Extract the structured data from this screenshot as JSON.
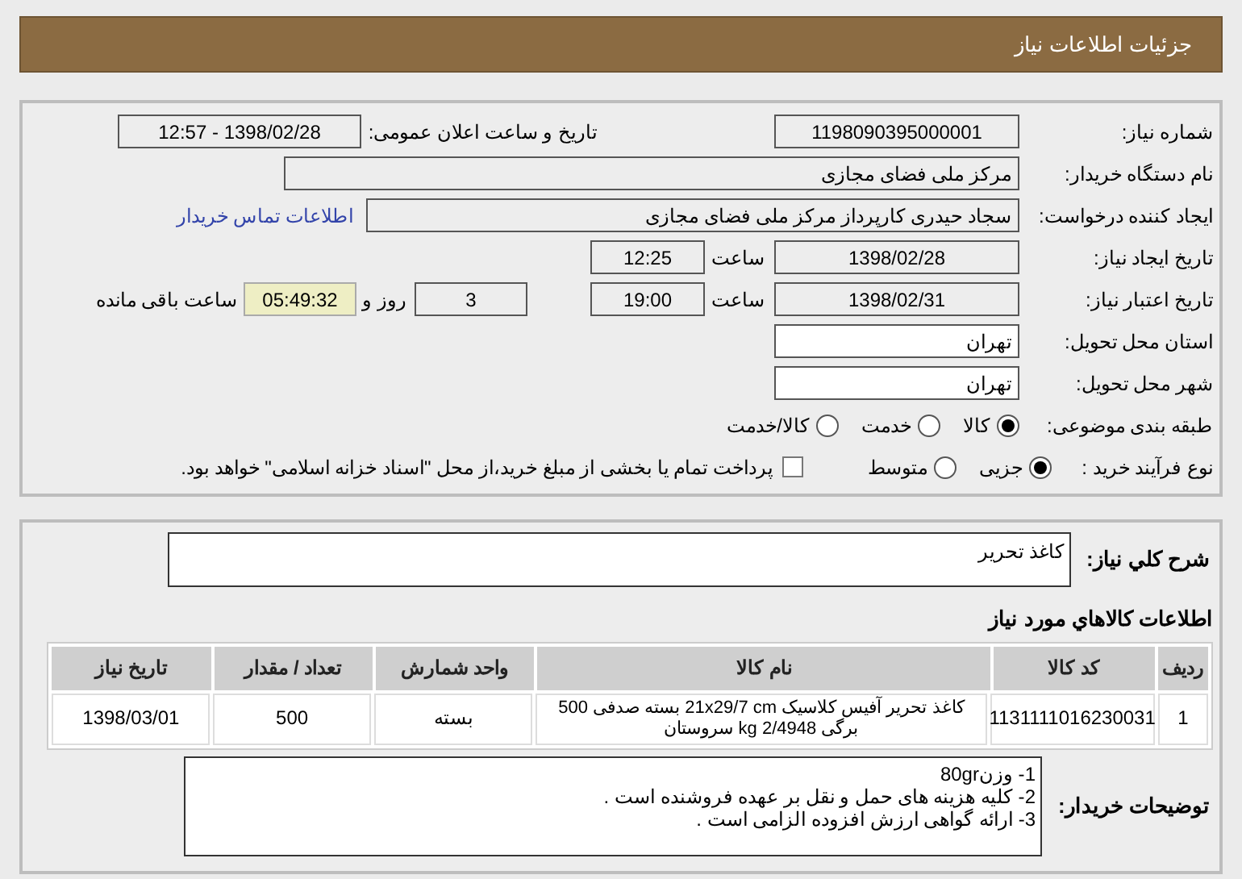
{
  "header": {
    "title": "جزئیات اطلاعات نیاز"
  },
  "fields": {
    "need_number": {
      "label": "شماره نیاز:",
      "value": "1198090395000001"
    },
    "announce": {
      "label": "تاریخ و ساعت اعلان عمومی:",
      "value": "1398/02/28 - 12:57"
    },
    "buyer": {
      "label": "نام دستگاه خریدار:",
      "value": "مرکز ملی فضای مجازی"
    },
    "creator": {
      "label": "ایجاد کننده درخواست:",
      "value": "سجاد حیدری کارپرداز مرکز ملی فضای مجازی",
      "link": "اطلاعات تماس خریدار"
    },
    "created": {
      "label": "تاریخ ایجاد نیاز:",
      "date": "1398/02/28",
      "time_label": "ساعت",
      "time": "12:25"
    },
    "valid": {
      "label": "تاریخ اعتبار نیاز:",
      "date": "1398/02/31",
      "time_label": "ساعت",
      "time": "19:00",
      "days": "3",
      "days_label": "روز و",
      "remaining": "05:49:32",
      "remaining_label": "ساعت باقی مانده"
    },
    "province": {
      "label": "استان محل تحویل:",
      "value": "تهران"
    },
    "city": {
      "label": "شهر محل تحویل:",
      "value": "تهران"
    },
    "category": {
      "label": "طبقه بندی موضوعی:",
      "options": [
        {
          "label": "کالا",
          "selected": true
        },
        {
          "label": "خدمت",
          "selected": false
        },
        {
          "label": "کالا/خدمت",
          "selected": false
        }
      ]
    },
    "process": {
      "label": "نوع فرآیند خرید :",
      "options": [
        {
          "label": "جزیی",
          "selected": true
        },
        {
          "label": "متوسط",
          "selected": false
        }
      ],
      "payment": {
        "label": "پرداخت تمام یا بخشی از مبلغ خرید،از محل \"اسناد خزانه اسلامی\" خواهد بود.",
        "checked": false
      }
    }
  },
  "summary": {
    "label": "شرح کلي نياز:",
    "value": "کاغذ تحریر"
  },
  "items": {
    "title": "اطلاعات کالاهاي مورد نياز",
    "columns": [
      "ردیف",
      "کد کالا",
      "نام کالا",
      "واحد شمارش",
      "تعداد / مقدار",
      "تاریخ نیاز"
    ],
    "rows": [
      [
        "1",
        "1131111016230031",
        "کاغذ تحریر آفیس کلاسیک 21x29/7 cm بسته صدفی 500 برگی 2/4948 kg سروستان",
        "بسته",
        "500",
        "1398/03/01"
      ]
    ]
  },
  "notes": {
    "label": "توضیحات خریدار:",
    "lines": [
      "1- وزن80gr",
      "2- کلیه هزینه های حمل و نقل بر عهده فروشنده است .",
      "3- ارائه گواهی ارزش افزوده الزامی است ."
    ]
  }
}
